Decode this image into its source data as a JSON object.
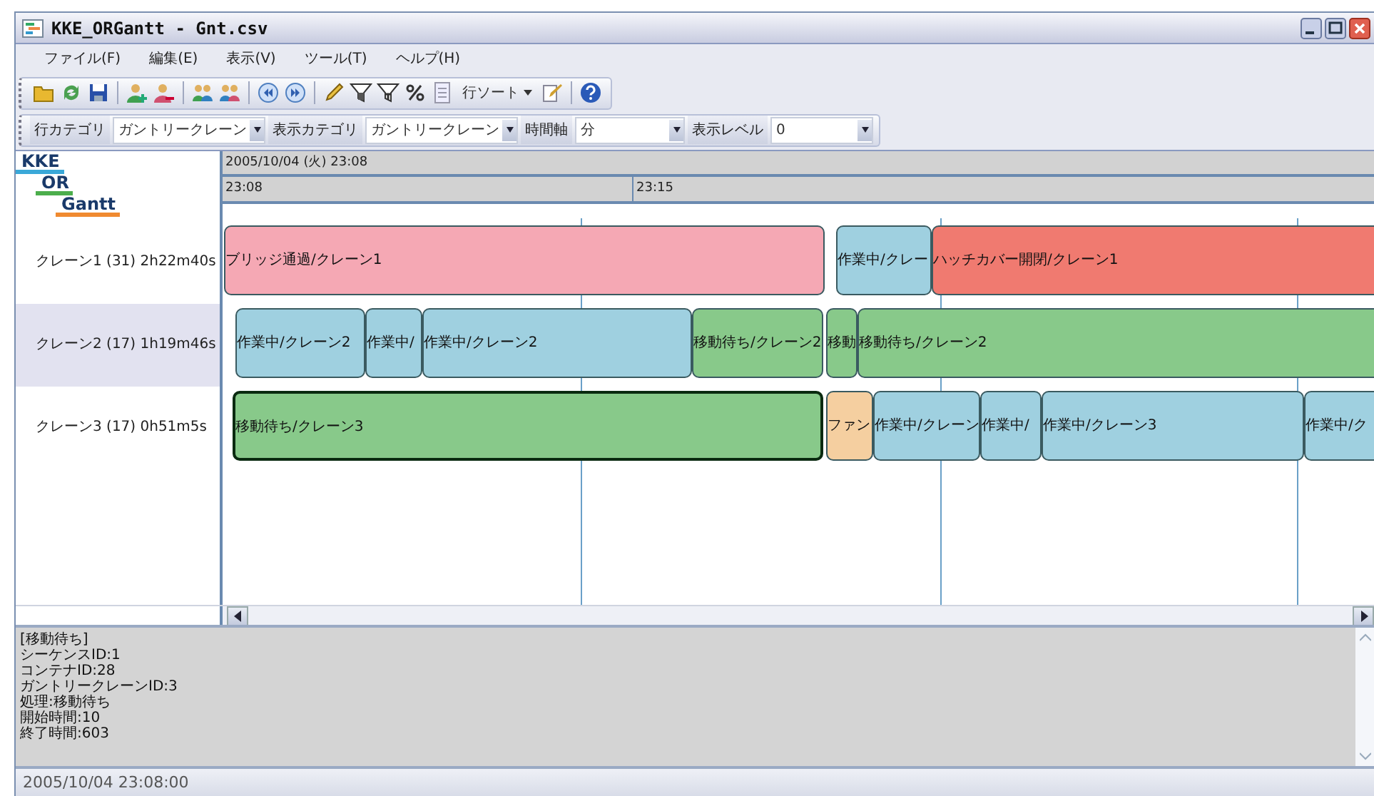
{
  "window": {
    "title": "KKE_ORGantt - Gnt.csv"
  },
  "menu": [
    "ファイル(F)",
    "編集(E)",
    "表示(V)",
    "ツール(T)",
    "ヘルプ(H)"
  ],
  "toolbar": {
    "sort_label": "行ソート"
  },
  "combos": [
    {
      "label": "行カテゴリ",
      "value": "ガントリークレーン"
    },
    {
      "label": "表示カテゴリ",
      "value": "ガントリークレーン"
    },
    {
      "label": "時間軸",
      "value": "分"
    },
    {
      "label": "表示レベル",
      "value": "0"
    }
  ],
  "logo": [
    "KKE",
    "OR",
    "Gantt"
  ],
  "timeline": {
    "date": "2005/10/04 (火) 23:08",
    "ticks": [
      "23:08",
      "23:15"
    ]
  },
  "rows": [
    {
      "label": "クレーン1 (31) 2h22m40s",
      "selected": false,
      "bars": [
        {
          "text": "ブリッジ通過/クレーン1",
          "color": "#f5a8b4",
          "selected": false
        },
        {
          "text": "作業中/クレー",
          "color": "#9fd0e0",
          "selected": false
        },
        {
          "text": "ハッチカバー開閉/クレーン1",
          "color": "#f07a70",
          "selected": false
        }
      ]
    },
    {
      "label": "クレーン2 (17) 1h19m46s",
      "selected": true,
      "bars": [
        {
          "text": "作業中/クレーン2",
          "color": "#9fd0e0",
          "selected": false
        },
        {
          "text": "作業中/",
          "color": "#9fd0e0",
          "selected": false
        },
        {
          "text": "作業中/クレーン2",
          "color": "#9fd0e0",
          "selected": false
        },
        {
          "text": "移動待ち/クレーン2",
          "color": "#88c98a",
          "selected": false
        },
        {
          "text": "移動",
          "color": "#88c98a",
          "selected": false
        },
        {
          "text": "移動待ち/クレーン2",
          "color": "#88c98a",
          "selected": false
        }
      ]
    },
    {
      "label": "クレーン3 (17) 0h51m5s",
      "selected": false,
      "bars": [
        {
          "text": "移動待ち/クレーン3",
          "color": "#88c98a",
          "selected": true
        },
        {
          "text": "ファン",
          "color": "#f5cfa0",
          "selected": false
        },
        {
          "text": "作業中/クレーン",
          "color": "#9fd0e0",
          "selected": false
        },
        {
          "text": "作業中/",
          "color": "#9fd0e0",
          "selected": false
        },
        {
          "text": "作業中/クレーン3",
          "color": "#9fd0e0",
          "selected": false
        },
        {
          "text": "作業中/ク",
          "color": "#9fd0e0",
          "selected": false
        }
      ]
    }
  ],
  "info": [
    "[移動待ち]",
    "シーケンスID:1",
    "コンテナID:28",
    "ガントリークレーンID:3",
    "処理:移動待ち",
    "開始時間:10",
    "終了時間:603"
  ],
  "status_bar": "2005/10/04 23:08:00"
}
